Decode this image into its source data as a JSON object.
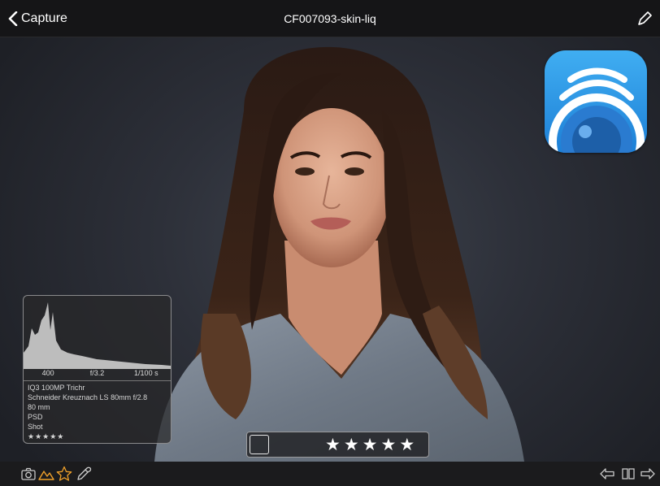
{
  "nav": {
    "back_label": "Capture",
    "title": "CF007093-skin-liq"
  },
  "info_panel": {
    "iso": "400",
    "aperture": "f/3.2",
    "shutter": "1/100 s",
    "camera": "IQ3 100MP Trichr",
    "lens": "Schneider Kreuznach LS 80mm f/2.8",
    "focal_length": "80 mm",
    "format": "PSD",
    "folder": "Shot",
    "mini_rating": "★★★★★"
  },
  "rating": {
    "selected": false,
    "stars": 5,
    "star_glyph": "★"
  },
  "icons": {
    "back": "chevron-left-icon",
    "edit": "pen-icon",
    "camera": "camera-icon",
    "exposure_warning": "mountain-warning-icon",
    "rating": "star-icon",
    "color_picker": "eyedropper-icon",
    "previous": "arrow-left-icon",
    "compare": "split-view-icon",
    "next": "arrow-right-icon"
  },
  "colors": {
    "accent_orange": "#f0a12a",
    "app_icon_blue": "#2b96e6",
    "bar_background": "#151517"
  }
}
